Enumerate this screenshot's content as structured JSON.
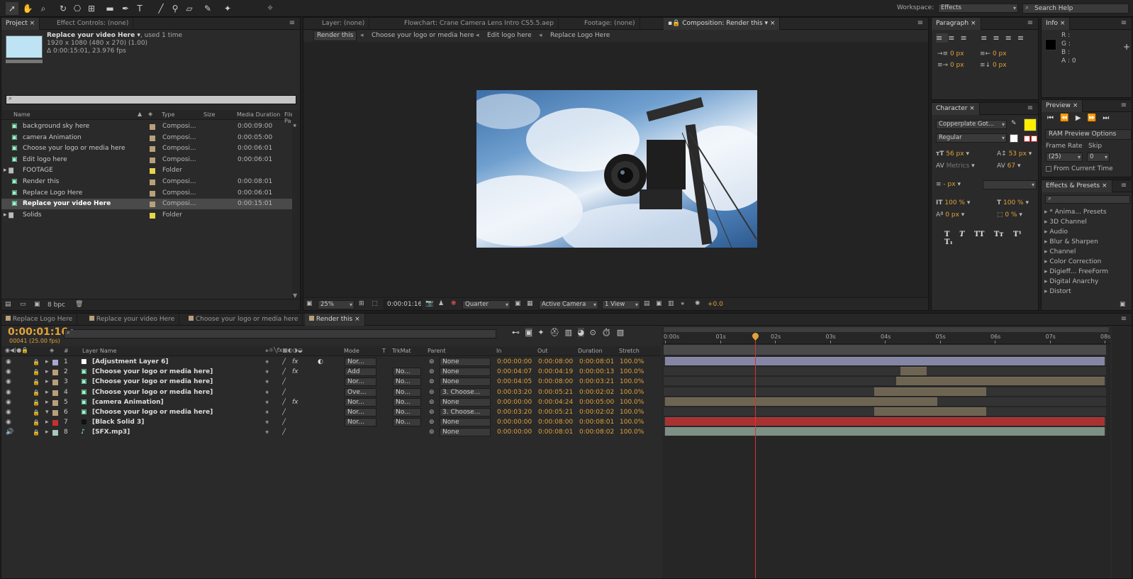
{
  "toolbar": {
    "workspace_label": "Workspace:",
    "workspace_value": "Effects",
    "search_placeholder": "Search Help"
  },
  "project": {
    "tab": "Project",
    "tab2": "Effect Controls: (none)",
    "item_name": "Replace your video Here",
    "used": ", used 1 time",
    "dims": "1920 x 1080  (480 x 270) (1.00)",
    "duration": "Δ 0:00:15:01, 23.976 fps",
    "search_value": "",
    "cols": {
      "name": "Name",
      "type": "Type",
      "size": "Size",
      "dur": "Media Duration",
      "file": "File Pa"
    },
    "items": [
      {
        "name": "background sky here",
        "type": "Composi...",
        "dur": "0:00:09:00",
        "color": "#b8a07a",
        "kind": "comp"
      },
      {
        "name": "camera Animation",
        "type": "Composi...",
        "dur": "0:00:05:00",
        "color": "#b8a07a",
        "kind": "comp"
      },
      {
        "name": "Choose your logo or media here",
        "type": "Composi...",
        "dur": "0:00:06:01",
        "color": "#b8a07a",
        "kind": "comp"
      },
      {
        "name": "Edit  logo here",
        "type": "Composi...",
        "dur": "0:00:06:01",
        "color": "#b8a07a",
        "kind": "comp"
      },
      {
        "name": "FOOTAGE",
        "type": "Folder",
        "dur": "",
        "color": "#e8d44a",
        "kind": "folder"
      },
      {
        "name": "Render this",
        "type": "Composi...",
        "dur": "0:00:08:01",
        "color": "#b8a07a",
        "kind": "comp"
      },
      {
        "name": "Replace Logo Here",
        "type": "Composi...",
        "dur": "0:00:06:01",
        "color": "#b8a07a",
        "kind": "comp"
      },
      {
        "name": "Replace your video Here",
        "type": "Composi...",
        "dur": "0:00:15:01",
        "color": "#b8a07a",
        "kind": "comp"
      },
      {
        "name": "Solids",
        "type": "Folder",
        "dur": "",
        "color": "#e8d44a",
        "kind": "folder"
      }
    ],
    "bpc": "8 bpc"
  },
  "viewer": {
    "tabs": [
      "Layer: (none)",
      "Flowchart: Crane Camera Lens Intro CS5.5.aep",
      "Footage: (none)",
      "Composition: Render this"
    ],
    "crumbs": [
      "Render this",
      "Choose your logo or media here",
      "Edit  logo here",
      "Replace Logo Here"
    ],
    "zoom": "25%",
    "time": "0:00:01:16",
    "resolution": "Quarter",
    "camera": "Active Camera",
    "view": "1 View",
    "exposure": "+0.0"
  },
  "paragraph": {
    "tab": "Paragraph",
    "vals": [
      "0 px",
      "0 px",
      "0 px",
      "0 px",
      "0 px"
    ]
  },
  "info": {
    "tab": "Info",
    "r": "R :",
    "g": "G :",
    "b": "B :",
    "a": "A :  0"
  },
  "preview": {
    "tab": "Preview",
    "ram": "RAM Preview Options",
    "frame_rate": "Frame Rate",
    "skip": "Skip",
    "fr_val": "(25)",
    "skip_val": "0",
    "from_current": "From Current Time"
  },
  "character": {
    "tab": "Character",
    "font": "Copperplate Got...",
    "style": "Regular",
    "size": "56 px",
    "leading": "53 px",
    "kern": "Metrics",
    "track": "67",
    "stroke": "- px",
    "vscale": "100 %",
    "hscale": "100 %",
    "baseline": "0 px",
    "tsume": "0 %",
    "fill_color": "#ffee00"
  },
  "effects": {
    "tab": "Effects & Presets",
    "items": [
      "* Anima... Presets",
      "3D Channel",
      "Audio",
      "Blur & Sharpen",
      "Channel",
      "Color Correction",
      "Digieff... FreeForm",
      "Digital Anarchy",
      "Distort"
    ]
  },
  "timeline": {
    "tabs": [
      "Replace Logo Here",
      "Replace your video Here",
      "Choose your logo or media here",
      "Render this"
    ],
    "timecode": "0:00:01:16",
    "frames": "00041 (25.00 fps)",
    "cols": {
      "name": "Layer Name",
      "mode": "Mode",
      "t": "T",
      "trk": "TrkMat",
      "parent": "Parent",
      "in": "In",
      "out": "Out",
      "dur": "Duration",
      "stretch": "Stretch"
    },
    "ruler": [
      "0:00s",
      "01s",
      "02s",
      "03s",
      "04s",
      "05s",
      "06s",
      "07s",
      "08s"
    ],
    "playhead_s": 1.64,
    "layers": [
      {
        "num": "1",
        "name": "[Adjustment Layer 6]",
        "color": "#a8a8d0",
        "mode": "Nor...",
        "trk": "",
        "parent": "None",
        "in": "0:00:00:00",
        "out": "0:00:08:00",
        "dur": "0:00:08:01",
        "stretch": "100.0%",
        "fx": true,
        "start": 0,
        "end": 8.0,
        "bar": "#8585a5",
        "twirl": "▸"
      },
      {
        "num": "2",
        "name": "[Choose your logo or media here]",
        "color": "#b8a07a",
        "mode": "Add",
        "trk": "No...",
        "parent": "None",
        "in": "0:00:04:07",
        "out": "0:00:04:19",
        "dur": "0:00:00:13",
        "stretch": "100.0%",
        "fx": true,
        "start": 4.28,
        "end": 4.76,
        "bar": "#6e6452",
        "twirl": "▸"
      },
      {
        "num": "3",
        "name": "[Choose your logo or media here]",
        "color": "#b8a07a",
        "mode": "Nor...",
        "trk": "No...",
        "parent": "None",
        "in": "0:00:04:05",
        "out": "0:00:08:00",
        "dur": "0:00:03:21",
        "stretch": "100.0%",
        "fx": false,
        "start": 4.2,
        "end": 8.0,
        "bar": "#6e6452",
        "twirl": "▸"
      },
      {
        "num": "4",
        "name": "[Choose your logo or media here]",
        "color": "#b8a07a",
        "mode": "Ove...",
        "trk": "No...",
        "parent": "3. Choose...",
        "in": "0:00:03:20",
        "out": "0:00:05:21",
        "dur": "0:00:02:02",
        "stretch": "100.0%",
        "fx": false,
        "start": 3.8,
        "end": 5.84,
        "bar": "#6e6452",
        "twirl": "▸"
      },
      {
        "num": "5",
        "name": "[camera Animation]",
        "color": "#b8a07a",
        "mode": "Nor...",
        "trk": "No...",
        "parent": "None",
        "in": "0:00:00:00",
        "out": "0:00:04:24",
        "dur": "0:00:05:00",
        "stretch": "100.0%",
        "fx": true,
        "start": 0,
        "end": 4.96,
        "bar": "#6e6452",
        "twirl": "▸"
      },
      {
        "num": "6",
        "name": "[Choose your logo or media here]",
        "color": "#b8a07a",
        "mode": "Nor...",
        "trk": "No...",
        "parent": "3. Choose...",
        "in": "0:00:03:20",
        "out": "0:00:05:21",
        "dur": "0:00:02:02",
        "stretch": "100.0%",
        "fx": false,
        "start": 3.8,
        "end": 5.84,
        "bar": "#6e6452",
        "twirl": "▾"
      },
      {
        "num": "7",
        "name": "[Black Solid 3]",
        "color": "#c83030",
        "mode": "Nor...",
        "trk": "No...",
        "parent": "None",
        "in": "0:00:00:00",
        "out": "0:00:08:00",
        "dur": "0:00:08:01",
        "stretch": "100.0%",
        "fx": false,
        "start": 0,
        "end": 8.0,
        "bar": "#a83232",
        "twirl": "▸"
      },
      {
        "num": "8",
        "name": "[SFX.mp3]",
        "color": "#a8c8b8",
        "mode": "",
        "trk": "",
        "parent": "None",
        "in": "0:00:00:00",
        "out": "0:00:08:01",
        "dur": "0:00:08:02",
        "stretch": "100.0%",
        "fx": false,
        "start": 0,
        "end": 8.0,
        "bar": "#7d9085",
        "twirl": "▸"
      }
    ]
  }
}
